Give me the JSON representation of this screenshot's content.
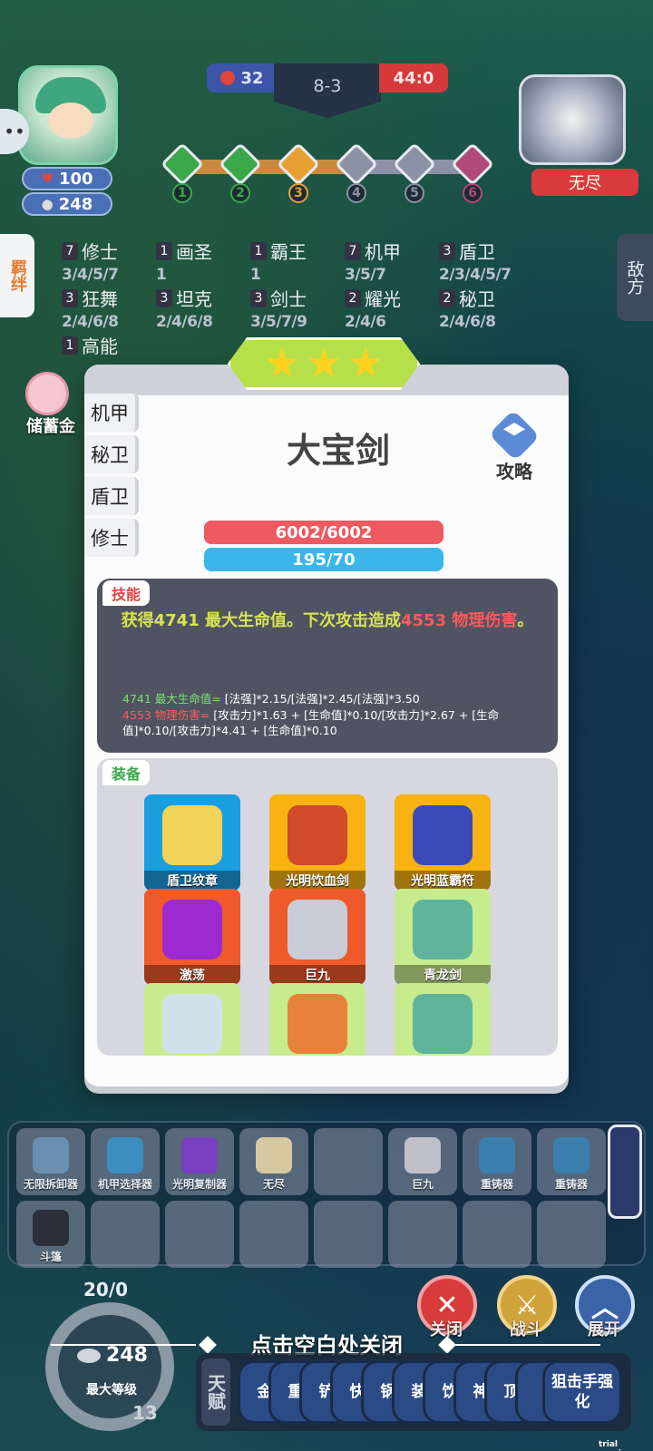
{
  "hud": {
    "hp_round": "32",
    "stage": "8-3",
    "timer": "44:0"
  },
  "player": {
    "side_hint": "••",
    "health": "100",
    "gold": "248"
  },
  "enemy": {
    "name": "无尽"
  },
  "route": {
    "nodes": [
      "1",
      "2",
      "3",
      "4",
      "5",
      "6"
    ],
    "colors": [
      "#3aa84a",
      "#3aa84a",
      "#e6a034",
      "#8c92a6",
      "#8c92a6",
      "#b04a7a"
    ]
  },
  "tabs": {
    "left": "羁绊",
    "right": "敌方"
  },
  "synergies": [
    {
      "count": "7",
      "name": "修士",
      "levels": "3/4/5/7"
    },
    {
      "count": "1",
      "name": "画圣",
      "levels": "1"
    },
    {
      "count": "1",
      "name": "霸王",
      "levels": "1"
    },
    {
      "count": "7",
      "name": "机甲",
      "levels": "3/5/7"
    },
    {
      "count": "3",
      "name": "盾卫",
      "levels": "2/3/4/5/7"
    },
    {
      "count": "3",
      "name": "狂舞",
      "levels": "2/4/6/8"
    },
    {
      "count": "3",
      "name": "坦克",
      "levels": "2/4/6/8"
    },
    {
      "count": "3",
      "name": "剑士",
      "levels": "3/5/7/9"
    },
    {
      "count": "2",
      "name": "耀光",
      "levels": "2/4/6"
    },
    {
      "count": "2",
      "name": "秘卫",
      "levels": "2/4/6/8"
    },
    {
      "count": "1",
      "name": "高能",
      "levels": ""
    }
  ],
  "piggy": {
    "label": "储蓄金"
  },
  "modal": {
    "stars": 3,
    "tags": [
      "机甲",
      "秘卫",
      "盾卫",
      "修士"
    ],
    "title": "大宝剑",
    "guide_label": "攻略",
    "hp_bar": "6002/6002",
    "mp_bar": "195/70",
    "skill": {
      "tag": "技能",
      "desc_pre": "获得",
      "desc_val1": "4741",
      "desc_mid": " 最大生命值。下次攻击造成",
      "desc_val2": "4553 物理伤害",
      "desc_end": "。",
      "formula1_head": "4741 最大生命值=",
      "formula1_body": " [法强]*2.15/[法强]*2.45/[法强]*3.50",
      "formula2_head": "4553 物理伤害=",
      "formula2_body": " [攻击力]*1.63 + [生命值]*0.10/[攻击力]*2.67 + [生命值]*0.10/[攻击力]*4.41 + [生命值]*0.10"
    },
    "equip": {
      "tag": "装备",
      "items": [
        {
          "name": "盾卫纹章",
          "bg": "blue"
        },
        {
          "name": "光明饮血剑",
          "bg": "gold"
        },
        {
          "name": "光明蓝霸符",
          "bg": "gold"
        },
        {
          "name": "激荡",
          "bg": "red"
        },
        {
          "name": "巨九",
          "bg": "red"
        },
        {
          "name": "青龙剑",
          "bg": "lime"
        },
        {
          "name": "",
          "bg": "lime"
        },
        {
          "name": "",
          "bg": "lime"
        },
        {
          "name": "",
          "bg": "lime"
        }
      ]
    }
  },
  "bench": {
    "row1": [
      "无限拆卸器",
      "机甲选择器",
      "光明复制器",
      "无尽",
      "",
      "巨九",
      "重铸器",
      "重铸器"
    ],
    "row2": [
      "斗篷",
      "",
      "",
      "",
      "",
      "",
      "",
      ""
    ]
  },
  "level": {
    "top": "20/0",
    "cost": "248",
    "label": "最大等级",
    "num": "13"
  },
  "buttons": {
    "close": "关闭",
    "fight": "战斗",
    "expand": "展开"
  },
  "hint": "点击空白处关闭",
  "talents": {
    "label": "天赋",
    "items": [
      "金",
      "重",
      "铲",
      "快",
      "锅",
      "装",
      "饮",
      "神",
      "顶",
      "【",
      "狙击手强化"
    ]
  },
  "trial": "trial version"
}
